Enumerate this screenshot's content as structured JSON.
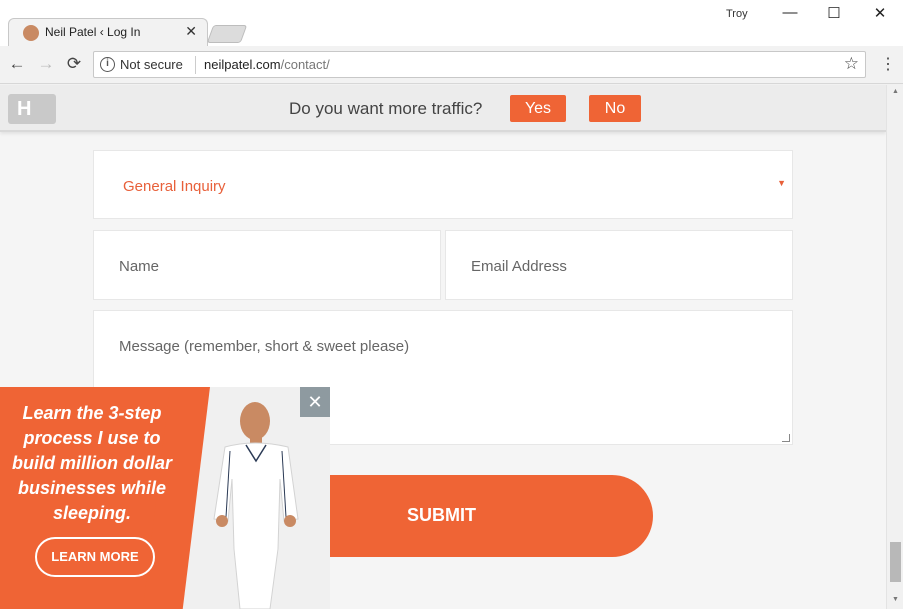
{
  "browser": {
    "tab_title": "Neil Patel ‹ Log In",
    "tab_close": "✕",
    "profile_name": "Troy",
    "window_controls": {
      "minimize": "—",
      "maximize": "☐",
      "close": "✕"
    },
    "nav": {
      "back": "←",
      "forward": "→",
      "reload": "⟳",
      "menu": "⋮"
    },
    "security_label": "Not secure",
    "url_host": "neilpatel.com",
    "url_path": "/contact/",
    "star": "☆",
    "info": "i"
  },
  "topbar": {
    "logo_mark": "H",
    "prompt": "Do you want more traffic?",
    "yes_label": "Yes",
    "no_label": "No"
  },
  "form": {
    "inquiry_selected": "General Inquiry",
    "caret": "▼",
    "name_placeholder": "Name",
    "email_placeholder": "Email Address",
    "message_placeholder": "Message  (remember, short & sweet please)",
    "submit_label": "SUBMIT"
  },
  "promo": {
    "headline": "Learn the 3-step process I use to build million dollar businesses while sleeping.",
    "cta_label": "LEARN MORE",
    "close": "✕"
  },
  "colors": {
    "accent": "#ef6435",
    "close_bg": "#8e9aa0"
  }
}
